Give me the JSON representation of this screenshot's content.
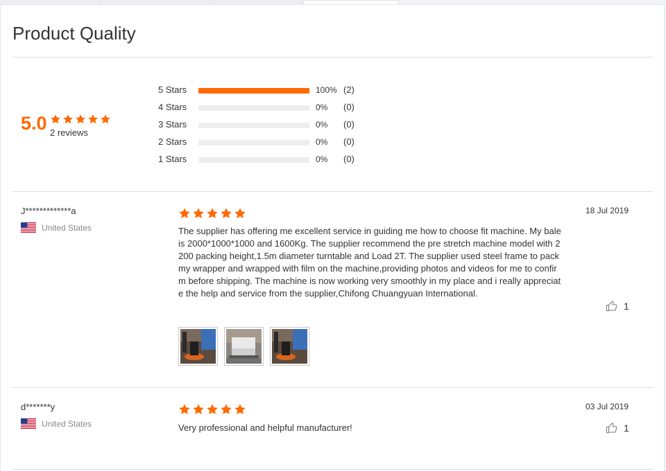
{
  "section": {
    "title": "Product Quality"
  },
  "summary": {
    "score": "5.0",
    "review_count_text": "2 reviews",
    "distribution": [
      {
        "label": "5 Stars",
        "pct_text": "100%",
        "pct": 100,
        "count_text": "(2)"
      },
      {
        "label": "4 Stars",
        "pct_text": "0%",
        "pct": 0,
        "count_text": "(0)"
      },
      {
        "label": "3 Stars",
        "pct_text": "0%",
        "pct": 0,
        "count_text": "(0)"
      },
      {
        "label": "2 Stars",
        "pct_text": "0%",
        "pct": 0,
        "count_text": "(0)"
      },
      {
        "label": "1 Stars",
        "pct_text": "0%",
        "pct": 0,
        "count_text": "(0)"
      }
    ]
  },
  "reviews": [
    {
      "reviewer": "J*************a",
      "country": "United States",
      "rating": 5,
      "date": "18 Jul 2019",
      "text": "The supplier has offering me excellent service in guiding me how to choose fit machine. My bale is 2000*1000*1000 and 1600Kg. The supplier recommend the pre stretch machine model with 2200 packing height,1.5m diameter turntable and Load 2T. The supplier used steel frame to pack my wrapper and wrapped with film on the machine,providing photos and videos for me to confirm before shipping. The machine is now working very smoothly in my place and i really appreciate the help and service from the supplier,Chifong Chuangyuan International.",
      "likes": "1",
      "photo_count": 3
    },
    {
      "reviewer": "d*******y",
      "country": "United States",
      "rating": 5,
      "date": "03 Jul 2019",
      "text": "Very professional and helpful manufacturer!",
      "likes": "1",
      "photo_count": 0
    }
  ],
  "colors": {
    "accent": "#ff6a00",
    "track": "#eeeef0",
    "divider": "#dedede"
  },
  "icons": {
    "star": "star-icon",
    "like": "thumbs-up-icon",
    "flag": "us-flag-icon"
  }
}
